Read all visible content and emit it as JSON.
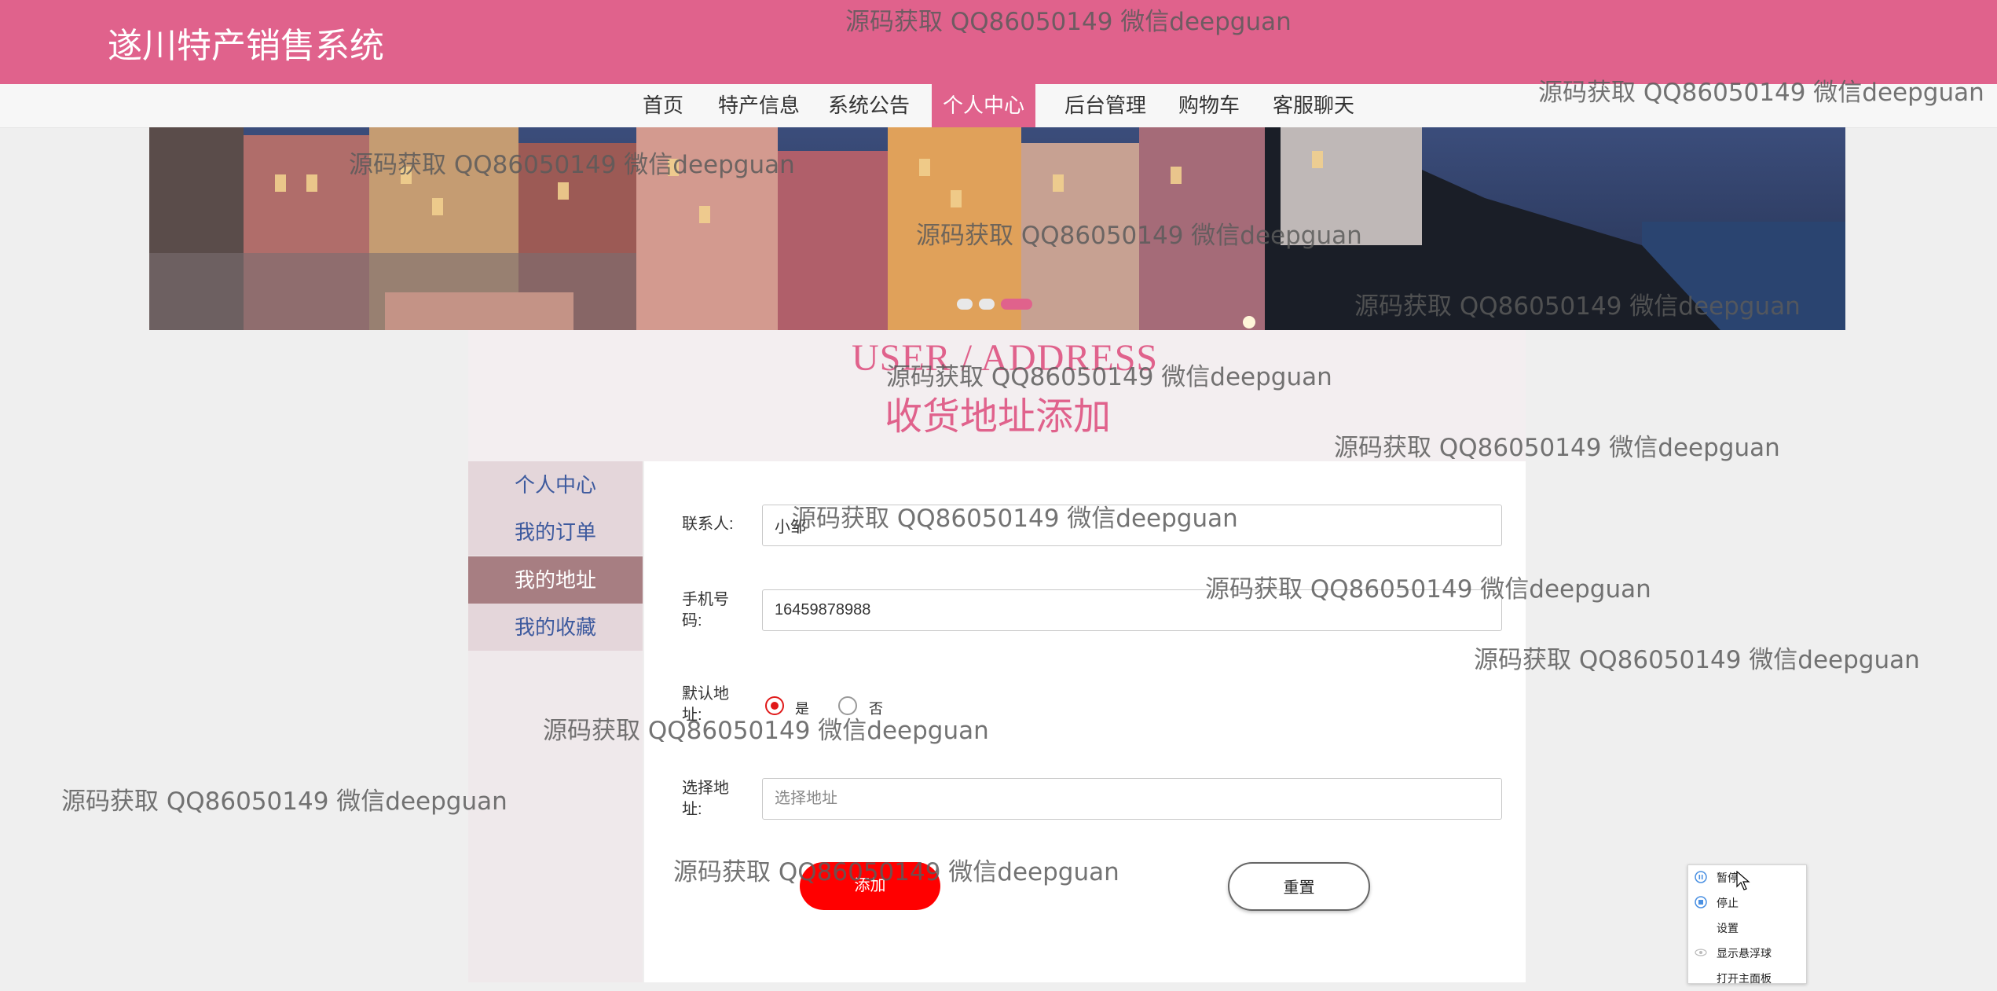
{
  "header": {
    "site_title": "遂川特产销售系统",
    "brand_color": "#e0628c"
  },
  "nav": {
    "items": [
      {
        "label": "首页"
      },
      {
        "label": "特产信息"
      },
      {
        "label": "系统公告"
      },
      {
        "label": "个人中心",
        "active": true
      },
      {
        "label": "后台管理"
      },
      {
        "label": "购物车"
      },
      {
        "label": "客服聊天"
      }
    ]
  },
  "banner": {
    "active_dot": 3
  },
  "page_title": {
    "en": "USER / ADDRESS",
    "cn": "收货地址添加"
  },
  "sidebar": {
    "items": [
      {
        "label": "个人中心"
      },
      {
        "label": "我的订单"
      },
      {
        "label": "我的地址",
        "active": true
      },
      {
        "label": "我的收藏"
      }
    ]
  },
  "form": {
    "contact_label": "联系人:",
    "contact_value": "小邹",
    "phone_label": "手机号码:",
    "phone_value": "16459878988",
    "default_label": "默认地址:",
    "default_yes": "是",
    "default_no": "否",
    "default_selected": "是",
    "address_label": "选择地址:",
    "address_placeholder": "选择地址",
    "add_button": "添加",
    "reset_button": "重置"
  },
  "watermark_text": "源码获取 QQ86050149 微信deepguan",
  "context_menu": {
    "items": [
      {
        "label": "暂停",
        "icon": "pause-icon"
      },
      {
        "label": "停止",
        "icon": "stop-icon"
      },
      {
        "label": "设置",
        "icon": ""
      },
      {
        "label": "显示悬浮球",
        "icon": "eye-icon"
      },
      {
        "label": "打开主面板",
        "icon": ""
      }
    ]
  }
}
